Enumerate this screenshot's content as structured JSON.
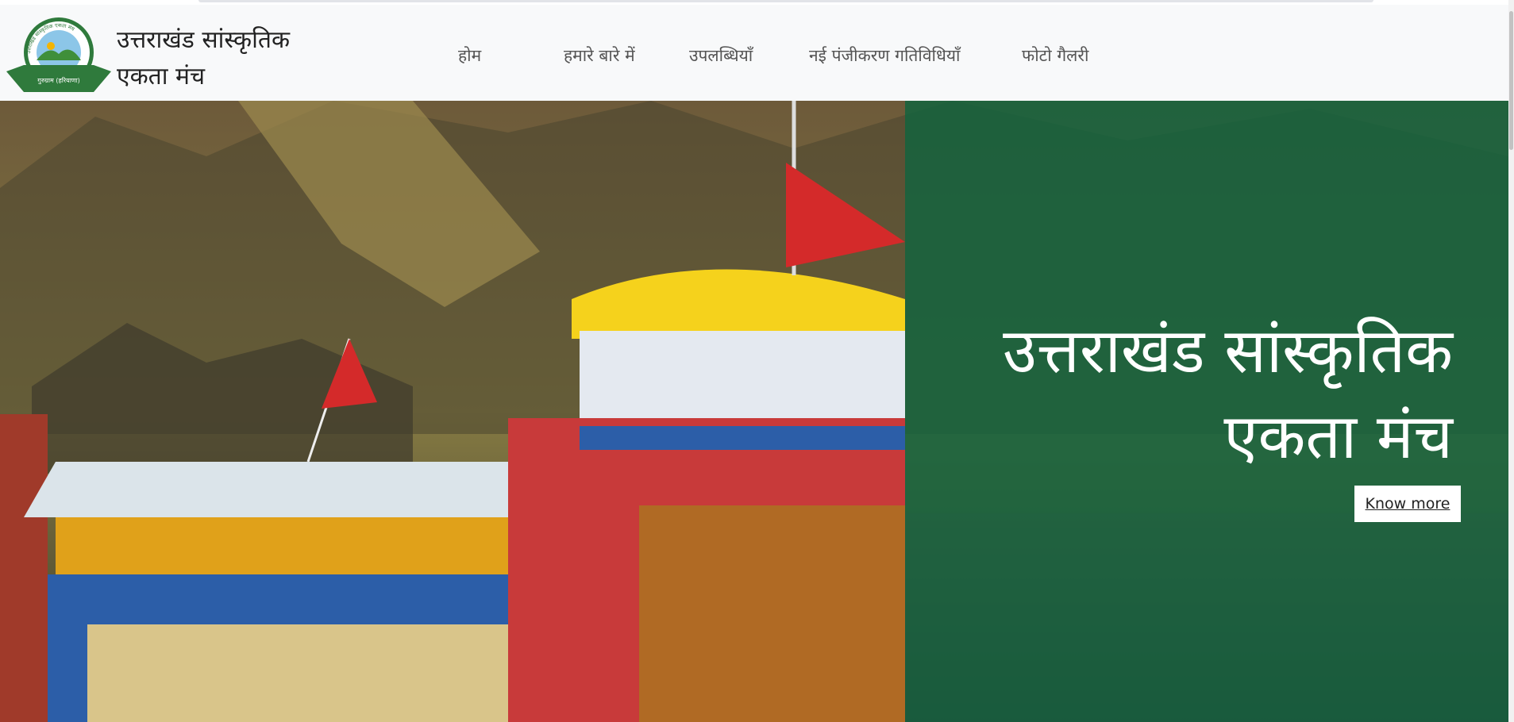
{
  "brand": {
    "line1": "उत्तराखंड सांस्कृतिक",
    "line2": "एकता मंच"
  },
  "logo": {
    "arc_text": "उत्तराखंड सांस्कृतिक एकता मंच",
    "ribbon_text": "गुरुग्राम (हरियाणा)"
  },
  "nav": {
    "items": [
      {
        "label": "होम"
      },
      {
        "label": "हमारे बारे में"
      },
      {
        "label": "उपलब्धियाँ"
      },
      {
        "label": "नई पंजीकरण गतिविधियाँ"
      },
      {
        "label": "फोटो गैलरी"
      }
    ]
  },
  "hero": {
    "title_line1": "उत्तराखंड सांस्कृतिक",
    "title_line2": "एकता मंच",
    "button_label": "Know more",
    "overlay_color": "#0a623e"
  }
}
